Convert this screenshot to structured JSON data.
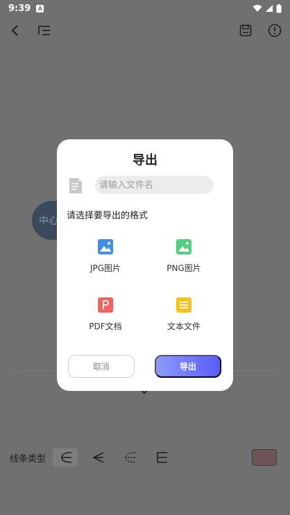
{
  "status_bar": {
    "time": "9:39",
    "badge": "A"
  },
  "toolbar": {
    "back_icon": "chevron-left-icon",
    "outline_icon": "outline-list-icon",
    "save_icon": "save-icon",
    "info_icon": "info-icon"
  },
  "canvas": {
    "node_text": "中心"
  },
  "line_type": {
    "label": "线条类型"
  },
  "colors": {
    "swatch": "#6e5555",
    "accent_start": "#8e9bff",
    "accent_end": "#5a5cf5"
  },
  "dialog": {
    "title": "导出",
    "filename_placeholder": "请输入文件名",
    "format_prompt": "请选择要导出的格式",
    "formats": [
      {
        "label": "JPG图片",
        "icon": "image-icon",
        "color": "#3f8ee8"
      },
      {
        "label": "PNG图片",
        "icon": "image-icon",
        "color": "#4ed07f"
      },
      {
        "label": "PDF文档",
        "icon": "pdf-icon",
        "color": "#f0615f"
      },
      {
        "label": "文本文件",
        "icon": "text-file-icon",
        "color": "#f5c21f"
      }
    ],
    "cancel_label": "取消",
    "export_label": "导出"
  }
}
